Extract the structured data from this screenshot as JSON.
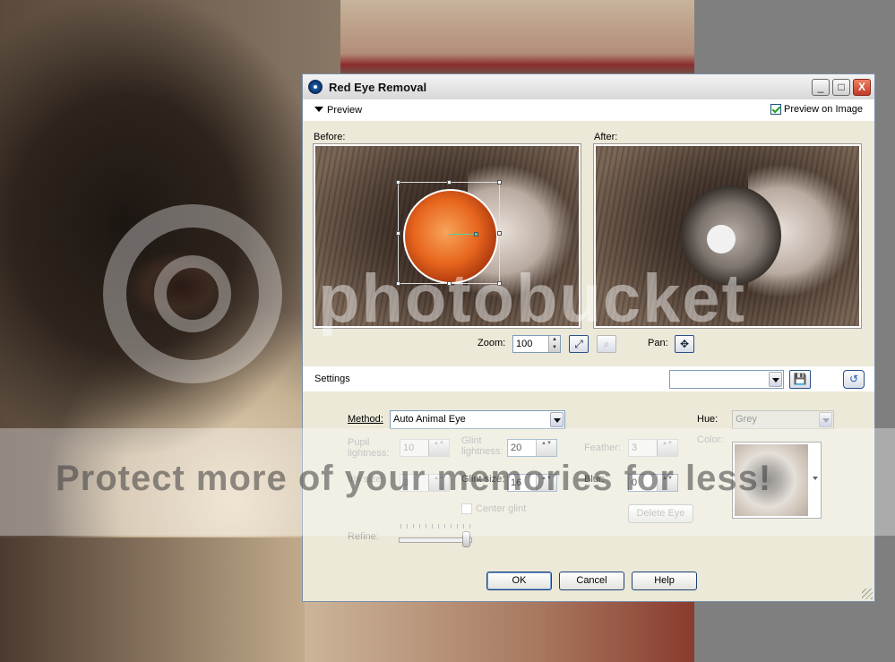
{
  "dialog": {
    "title": "Red Eye Removal",
    "buttons": {
      "minimize": "_",
      "maximize": "□",
      "close": "X"
    }
  },
  "preview": {
    "label": "Preview",
    "preview_on_image": {
      "label": "Preview on Image",
      "checked": true
    },
    "before_label": "Before:",
    "after_label": "After:",
    "zoom_label": "Zoom:",
    "zoom_value": "100",
    "pan_label": "Pan:"
  },
  "settings": {
    "label": "Settings",
    "preset_value": "",
    "method_label": "Method:",
    "method_value": "Auto Animal Eye",
    "hue_label": "Hue:",
    "hue_value": "Grey",
    "color_label": "Color:",
    "pupil_lightness_label": "Pupil lightness:",
    "pupil_lightness_value": "10",
    "glint_lightness_label": "Glint lightness:",
    "glint_lightness_value": "20",
    "feather_label": "Feather:",
    "feather_value": "3",
    "iris_size_label": "Iris size:",
    "iris_size_value": "3",
    "glint_size_label": "Glint size:",
    "glint_size_value": "16",
    "blur_label": "Blur:",
    "blur_value": "0",
    "center_glint_label": "Center glint",
    "center_glint_checked": false,
    "delete_eye_label": "Delete Eye",
    "refine_label": "Refine:"
  },
  "footer": {
    "ok": "OK",
    "cancel": "Cancel",
    "help": "Help"
  },
  "watermark": {
    "brand": "photobucket",
    "tagline": "Protect more of your memories for less!"
  }
}
